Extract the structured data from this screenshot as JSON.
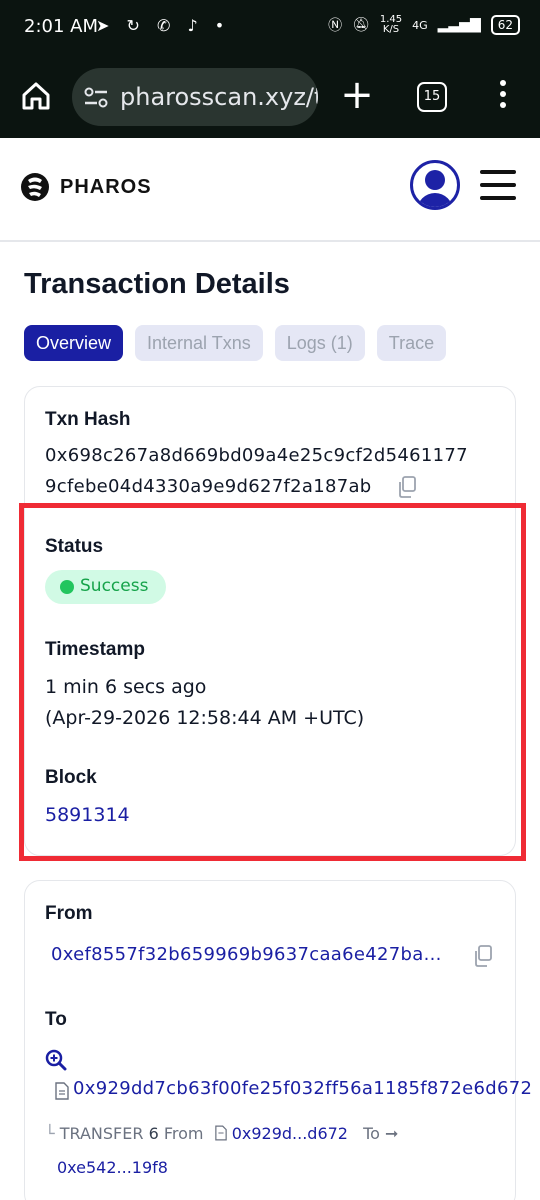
{
  "status_bar": {
    "time": "2:01 AM",
    "app_icons": "➤ ↻ ✆ ♪ •",
    "speed_value": "1.45",
    "speed_unit": "K/S",
    "network": "4G",
    "battery": "62"
  },
  "browser": {
    "url": "pharosscan.xyz/t",
    "tab_count": "15",
    "new_tab_label": "+"
  },
  "site": {
    "brand": "PHAROS"
  },
  "page": {
    "title": "Transaction Details",
    "tabs": [
      {
        "label": "Overview",
        "active": true
      },
      {
        "label": "Internal Txns",
        "active": false
      },
      {
        "label": "Logs (1)",
        "active": false
      },
      {
        "label": "Trace",
        "active": false
      }
    ]
  },
  "overview": {
    "txn_hash_label": "Txn Hash",
    "txn_hash_line1": "0x698c267a8d669bd09a4e25c9cf2d5461177",
    "txn_hash_line2": "9cfebe04d4330a9e9d627f2a187ab",
    "status_label": "Status",
    "status_value": "Success",
    "timestamp_label": "Timestamp",
    "timestamp_relative": "1 min 6 secs ago",
    "timestamp_absolute": "(Apr-29-2026 12:58:44 AM +UTC)",
    "block_label": "Block",
    "block_value": "5891314"
  },
  "parties": {
    "from_label": "From",
    "from_address": "0xef8557f32b659969b9637caa6e427ba...",
    "to_label": "To",
    "to_address": "0x929dd7cb63f00fe25f032ff56a1185f872e6d672",
    "transfer_prefix": "TRANSFER",
    "transfer_count": "6",
    "transfer_from_label": "From",
    "transfer_contract": "0x929d...d672",
    "transfer_to_label": "To ➞",
    "transfer_to_address": "0xe542...19f8"
  },
  "colors": {
    "accent": "#1a1fa3",
    "success": "#22c55e",
    "highlight": "#ef2b35"
  }
}
